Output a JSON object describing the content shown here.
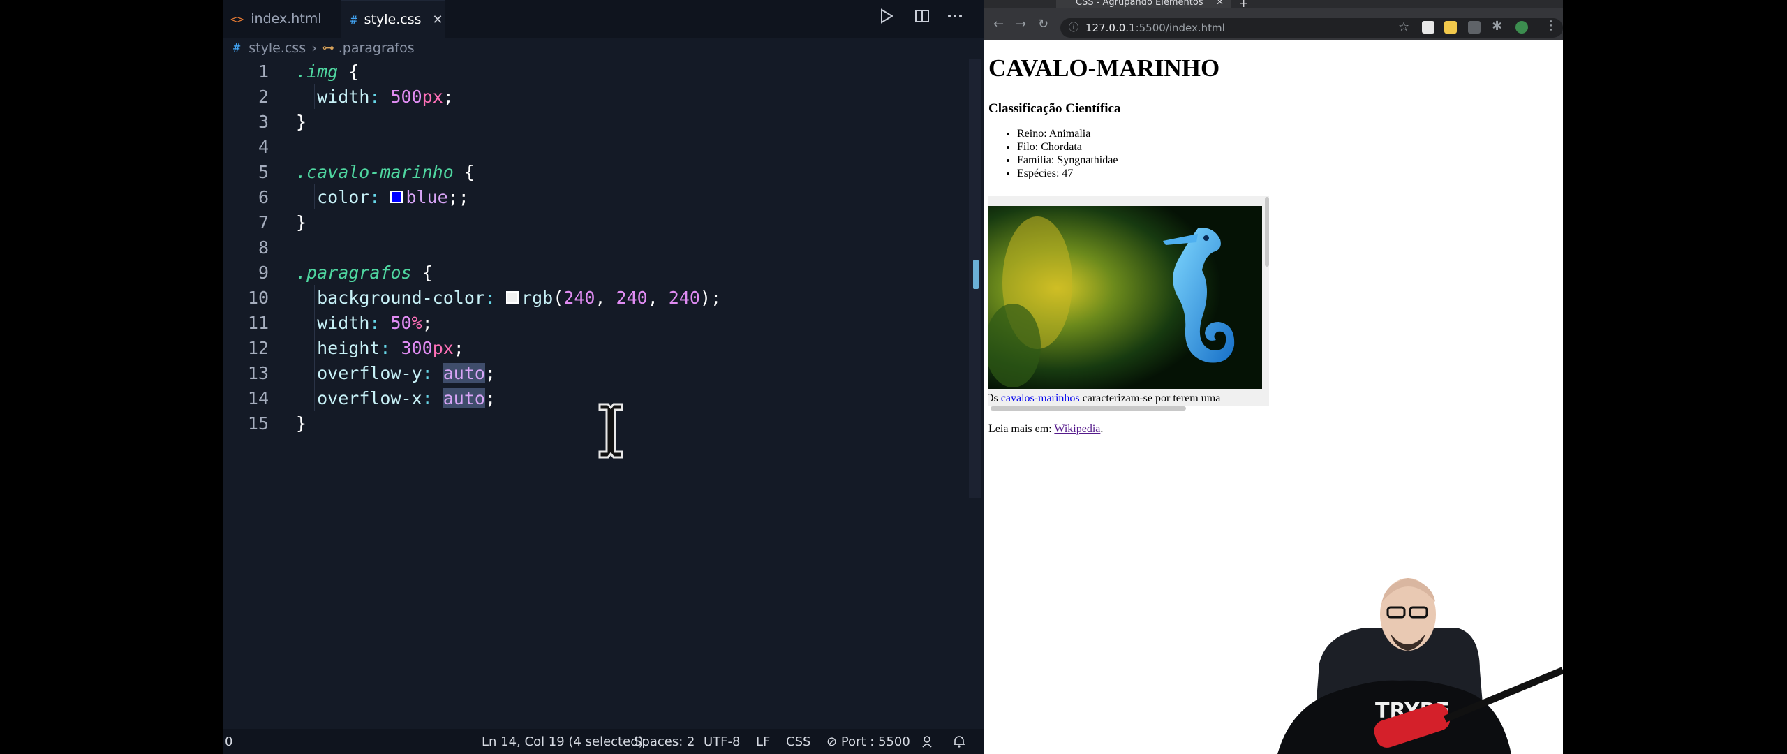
{
  "vscode": {
    "tabs": [
      {
        "icon": "<>",
        "label": "index.html"
      },
      {
        "icon": "#",
        "label": "style.css",
        "close": "✕"
      }
    ],
    "breadcrumb": {
      "file": "style.css",
      "symbol": ".paragrafos"
    },
    "code_lines": [
      "1",
      "2",
      "3",
      "4",
      "5",
      "6",
      "7",
      "8",
      "9",
      "10",
      "11",
      "12",
      "13",
      "14",
      "15"
    ],
    "code": {
      "l1_sel": ".img",
      "l1_brace": "{",
      "l2_prop": "width",
      "l2_num": "500",
      "l2_unit": "px",
      "l3": "}",
      "l5_sel": ".cavalo-marinho",
      "l5_brace": "{",
      "l6_prop": "color",
      "l6_val": "blue",
      "l7": "}",
      "l9_sel": ".paragrafos",
      "l9_brace": "{",
      "l10_prop": "background-color",
      "l10_fn": "rgb",
      "l10_a": "240",
      "l10_b": "240",
      "l10_c": "240",
      "l11_prop": "width",
      "l11_num": "50",
      "l11_unit": "%",
      "l12_prop": "height",
      "l12_num": "300",
      "l12_unit": "px",
      "l13_prop": "overflow-y",
      "l13_val": "auto",
      "l14_prop": "overflow-x",
      "l14_val": "auto",
      "l15": "}"
    },
    "status": {
      "left": "0",
      "position": "Ln 14, Col 19 (4 selected)",
      "spaces": "Spaces: 2",
      "encoding": "UTF-8",
      "eol": "LF",
      "language": "CSS",
      "port": "Port : 5500"
    },
    "colors": {
      "accent_blue": "#42a5f5",
      "swatch_blue": "#0000ff",
      "swatch_white": "#f0f0f0"
    }
  },
  "browser": {
    "tab_title": "CSS - Agrupando Elementos",
    "tab_close": "✕",
    "new_tab": "+",
    "url_host": "127.0.0.1",
    "url_rest": ":5500/index.html",
    "page": {
      "title": "CAVALO-MARINHO",
      "subtitle": "Classificação Científica",
      "list": [
        "Reino: Animalia",
        "Filo: Chordata",
        "Família: Syngnathidae",
        "Espécies: 47"
      ],
      "para_prefix": "Os",
      "para_link": "cavalos-marinhos",
      "para_rest": "caracterizam-se por terem uma",
      "readmore_label": "Leia mais em:",
      "readmore_link": "Wikipedia",
      "readmore_end": "."
    }
  },
  "webcam": {
    "shirt_text": "TRYBE"
  }
}
